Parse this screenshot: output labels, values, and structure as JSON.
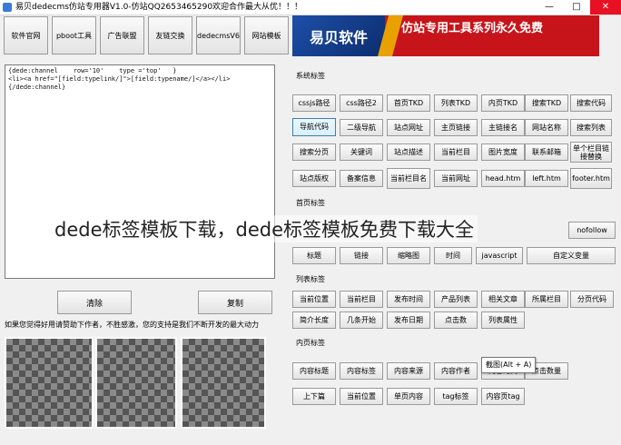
{
  "window": {
    "title": "易贝dedecms仿站专用器V1.0-仿站QQ2653465290欢迎合作最大从优！！！",
    "minimize": "—",
    "maximize": "□",
    "close": "✕"
  },
  "top_buttons": [
    "软件官网",
    "pboot工具",
    "广告联盟",
    "友链交换",
    "dedecmsV6",
    "网站模板"
  ],
  "banner": {
    "logo_text": "易贝软件",
    "slogan": "仿站专用工具系列永久免费"
  },
  "editor": {
    "content": "{dede:channel    row='10'    type ='top'   }\n<li><a href=\"[field:typelink/]\">[field:typename/]</a></li>\n{/dede:channel}"
  },
  "actions": {
    "clear": "清除",
    "copy": "复制"
  },
  "support_text": "如果您觉得好用请赞助下作者，不胜感激，您的支持是我们不断开发的最大动力",
  "sections": {
    "system": {
      "title": "系统标签",
      "buttons": [
        "cssjs路径",
        "css路径2",
        "首页TKD",
        "列表TKD",
        "内页TKD",
        "搜索TKD",
        "搜索代码",
        "导航代码",
        "二级导航",
        "站点网址",
        "主页链接",
        "主链接名",
        "网站名称",
        "搜索列表",
        "搜索分页",
        "关键词",
        "站点描述",
        "当前栏目",
        "图片宽度",
        "联系邮箱",
        "单个栏目链接替换",
        "站点版权",
        "备案信息",
        "当前栏目名",
        "当前网址",
        "head.htm",
        "left.htm",
        "footer.htm"
      ]
    },
    "home": {
      "title": "首页标签",
      "buttons": [
        "标题",
        "链接",
        "缩略图",
        "时间",
        "javascript",
        "自定义变量",
        "nofollow"
      ]
    },
    "list": {
      "title": "列表标签",
      "buttons": [
        "当前位置",
        "当前栏目",
        "发布时间",
        "产品列表",
        "相关文章",
        "所属栏目",
        "分页代码",
        "简介长度",
        "几条开始",
        "发布日期",
        "点击数",
        "列表属性"
      ]
    },
    "content": {
      "title": "内页标签",
      "buttons": [
        "内容标题",
        "内容标签",
        "内容来源",
        "内容作者",
        "内容时间",
        "点击数量",
        "上下篇",
        "当前位置",
        "单页内容",
        "tag标签",
        "内容页tag"
      ]
    }
  },
  "tooltip": "截图(Alt + A)",
  "overlay_caption": "dede标签模板下载，dede标签模板免费下载大全"
}
